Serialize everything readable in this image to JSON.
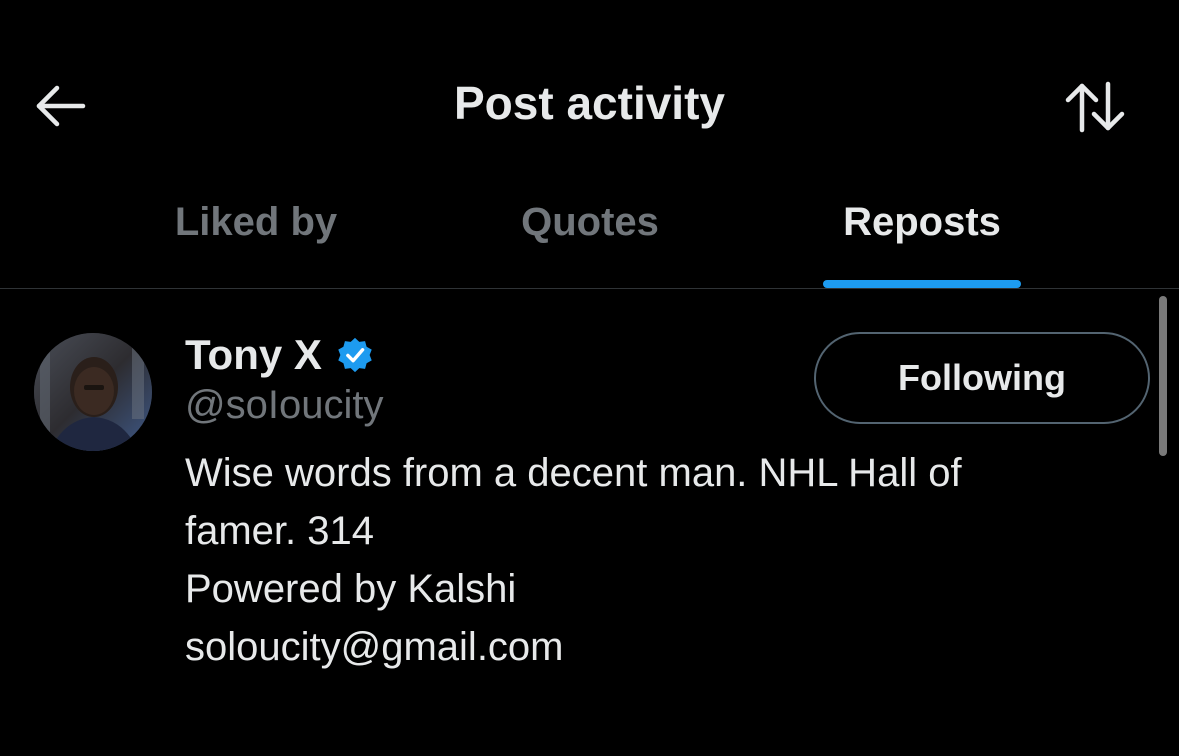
{
  "header": {
    "title": "Post activity",
    "back_icon": "arrow-left-icon",
    "sort_icon": "sort-arrows-icon"
  },
  "tabs": [
    {
      "label": "Liked by",
      "active": false
    },
    {
      "label": "Quotes",
      "active": false
    },
    {
      "label": "Reposts",
      "active": true
    }
  ],
  "user": {
    "display_name": "Tony X",
    "handle": "@soIoucity",
    "verified": true,
    "follow_label": "Following",
    "bio_lines": [
      "Wise words from a decent man. NHL Hall of",
      "famer. 314",
      "Powered by Kalshi",
      "soloucity@gmail.com"
    ]
  },
  "colors": {
    "background": "#000000",
    "accent": "#1d9bf0",
    "primary_text": "#e7e9ea",
    "secondary_text": "#71767b",
    "divider": "#2f3336"
  }
}
